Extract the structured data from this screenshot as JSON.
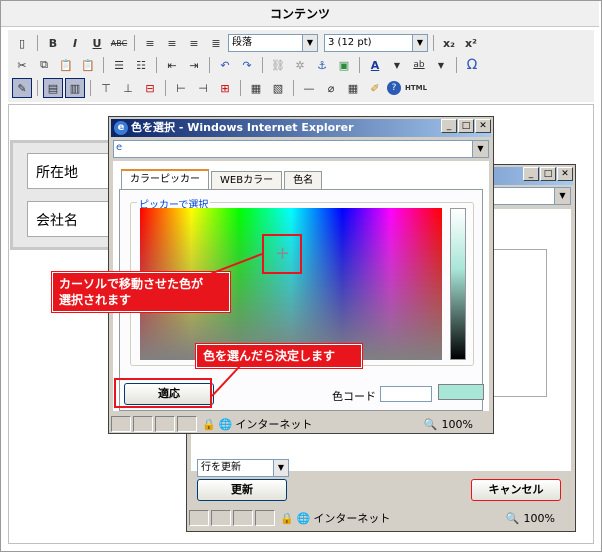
{
  "page": {
    "title": "コンテンツ"
  },
  "toolbar": {
    "format_select": "段落",
    "size_select": "3 (12 pt)",
    "html_label": "HTML"
  },
  "table_cells": [
    "所在地",
    "会社名"
  ],
  "back_window": {
    "action_select": "行を更新",
    "update_label": "更新",
    "cancel_label": "キャンセル",
    "status_zone": "インターネット",
    "zoom": "100%"
  },
  "front_window": {
    "title": "色を選択 - Windows Internet Explorer",
    "tabs": [
      "カラーピッカー",
      "WEBカラー",
      "色名"
    ],
    "group_label": "ピッカーで選択",
    "apply_label": "適応",
    "color_code_label": "色コード",
    "color_code_value": "",
    "selected_color": "#a8e6d8",
    "status_zone": "インターネット",
    "zoom": "100%"
  },
  "callouts": {
    "cursor_note": "カーソルで移動させた色が\n選択されます",
    "apply_note": "色を選んだら決定します"
  },
  "colors": {
    "accent_red": "#e8161c",
    "ie_title": "#0a246a"
  }
}
